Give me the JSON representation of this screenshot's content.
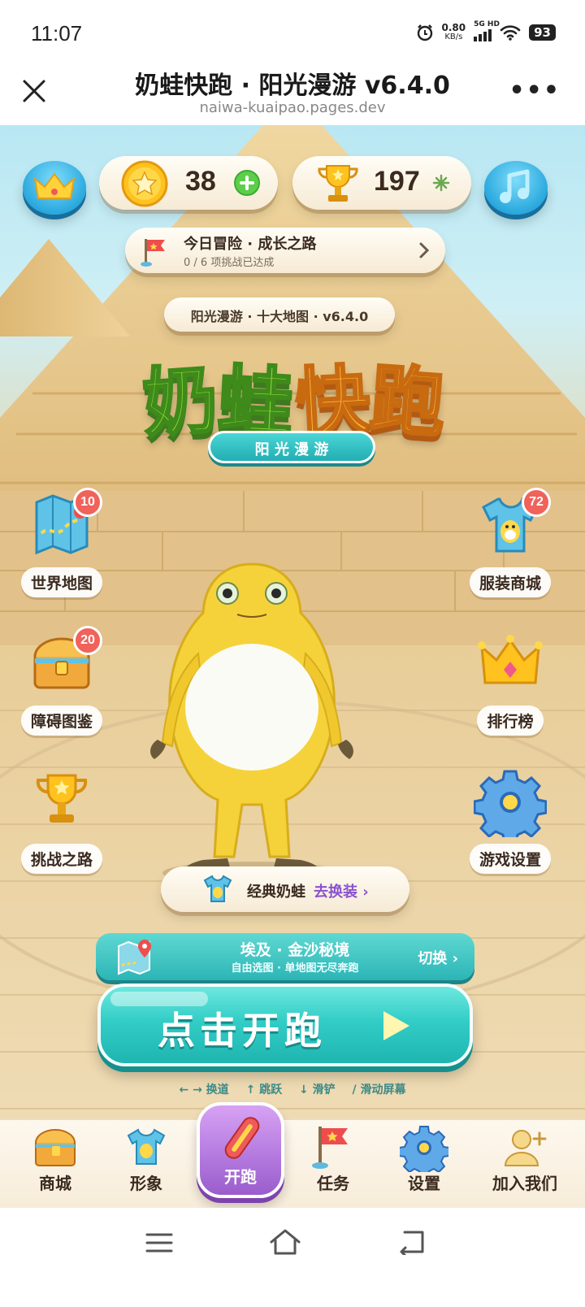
{
  "status_bar": {
    "time": "11:07",
    "net_speed": "0.80",
    "net_unit": "KB/s",
    "signal": "5G HD",
    "battery": "93"
  },
  "header": {
    "title": "奶蛙快跑 · 阳光漫游 v6.4.0",
    "url": "naiwa-kuaipao.pages.dev",
    "more": "•••"
  },
  "hud": {
    "coins": "38",
    "trophies": "197"
  },
  "daily": {
    "title": "今日冒险 · 成长之路",
    "progress": "0 / 6 项挑战已达成"
  },
  "banner": {
    "subtitle": "阳光漫游 · 十大地图 · v6.4.0",
    "logo_chars": [
      "奶",
      "蛙",
      "快",
      "跑"
    ],
    "tagline": "阳 光 漫 游"
  },
  "left_menu": [
    {
      "label": "世界地图",
      "badge": "10",
      "icon": "map-icon"
    },
    {
      "label": "障碍图鉴",
      "badge": "20",
      "icon": "chest-icon"
    },
    {
      "label": "挑战之路",
      "icon": "trophy-icon"
    }
  ],
  "right_menu": [
    {
      "label": "服装商城",
      "badge": "72",
      "icon": "shirt-icon"
    },
    {
      "label": "排行榜",
      "icon": "crown-icon"
    },
    {
      "label": "游戏设置",
      "icon": "gear-icon"
    }
  ],
  "outfit": {
    "name": "经典奶蛙",
    "action": "去换装 ›"
  },
  "map_select": {
    "name": "埃及 · 金沙秘境",
    "desc": "自由选图 · 单地图无尽奔跑",
    "switch": "切换 ›"
  },
  "start": {
    "label": "点击开跑"
  },
  "controls_hint": {
    "lane": "← → 换道",
    "jump": "↑ 跳跃",
    "slide": "↓ 滑铲",
    "swipe": "/  滑动屏幕"
  },
  "nav": [
    "商城",
    "形象",
    "开跑",
    "任务",
    "设置",
    "加入我们"
  ],
  "colors": {
    "accent_teal": "#2fc9c4",
    "pill_bg": "#fbf4e6",
    "badge_red": "#f0625a",
    "start_purple": "#b57be0"
  }
}
